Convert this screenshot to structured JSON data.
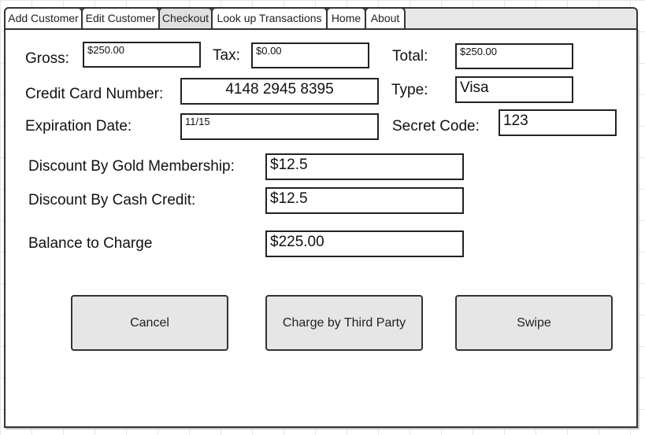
{
  "tabs": [
    {
      "label": "Add Customer"
    },
    {
      "label": "Edit Customer"
    },
    {
      "label": "Checkout"
    },
    {
      "label": "Look up Transactions"
    },
    {
      "label": "Home"
    },
    {
      "label": "About"
    }
  ],
  "active_tab": "Checkout",
  "checkout": {
    "gross_label": "Gross:",
    "gross_value": "$250.00",
    "tax_label": "Tax:",
    "tax_value": "$0.00",
    "total_label": "Total:",
    "total_value": "$250.00",
    "card_number_label": "Credit Card Number:",
    "card_number_value": "4148 2945 8395",
    "type_label": "Type:",
    "type_value": "Visa",
    "expiration_label": "Expiration Date:",
    "expiration_value": "11/15",
    "secret_code_label": "Secret Code:",
    "secret_code_value": "123",
    "gold_discount_label": "Discount By Gold Membership:",
    "gold_discount_value": "$12.5",
    "cash_credit_label": "Discount By Cash Credit:",
    "cash_credit_value": "$12.5",
    "balance_label": "Balance to Charge",
    "balance_value": "$225.00"
  },
  "buttons": {
    "cancel": "Cancel",
    "third_party": "Charge by Third Party",
    "swipe": "Swipe"
  }
}
